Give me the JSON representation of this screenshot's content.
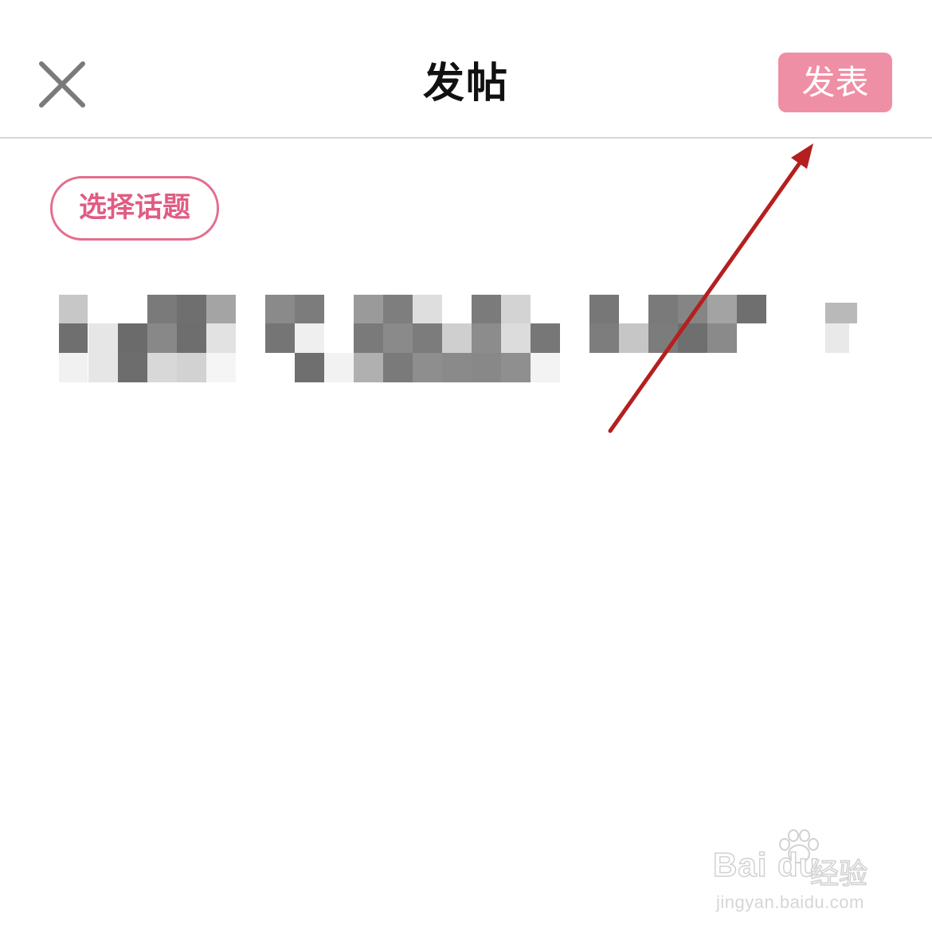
{
  "header": {
    "title": "发帖",
    "publish_label": "发表",
    "close_icon": "close-icon"
  },
  "main": {
    "topic_button_label": "选择话题"
  },
  "colors": {
    "accent": "#ef8fa5",
    "accent_text": "#e05c82",
    "annotation_arrow": "#b51f1f"
  },
  "watermark": {
    "brand": "Bai du",
    "label": "经验",
    "url": "jingyan.baidu.com"
  }
}
